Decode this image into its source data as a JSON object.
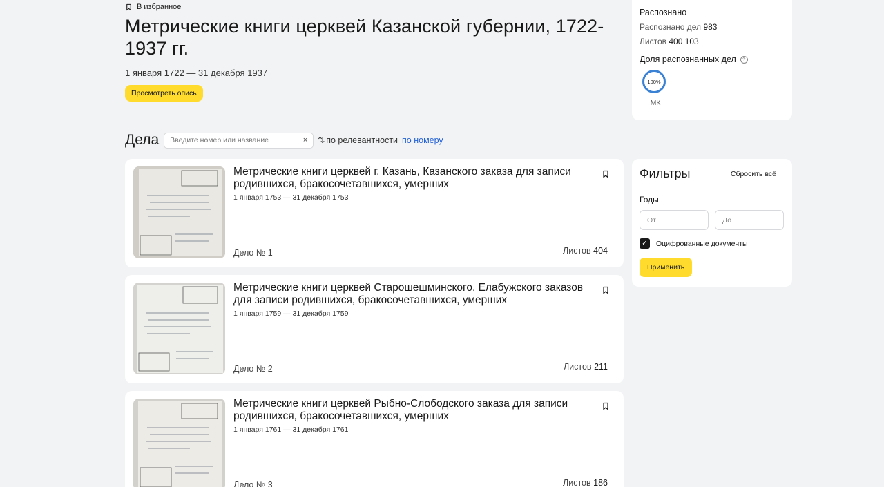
{
  "header": {
    "favorite_label": "В избранное",
    "title": "Метрические книги церквей Казанской губернии, 1722-1937 гг.",
    "date_range": "1 января 1722 — 31 декабря 1937",
    "inventory_button": "Просмотреть опись"
  },
  "cases_bar": {
    "title": "Дела",
    "search_placeholder": "Введите номер или название",
    "clear_icon": "×",
    "sort_icon": "⇅",
    "sort_relevance": "по релевантности",
    "sort_number": "по номеру"
  },
  "cases": [
    {
      "title": "Метрические книги церквей г. Казань, Казанского заказа для записи родившихся, бракосочетавшихся, умерших",
      "dates": "1 января 1753 — 31 декабря 1753",
      "case_no": "Дело № 1",
      "sheets_label": "Листов",
      "sheets": "404"
    },
    {
      "title": "Метрические книги церквей Старошешминского, Елабужского заказов для записи родившихся, бракосочетавшихся, умерших",
      "dates": "1 января 1759 — 31 декабря 1759",
      "case_no": "Дело № 2",
      "sheets_label": "Листов",
      "sheets": "211"
    },
    {
      "title": "Метрические книги церквей Рыбно-Слободского заказа для записи родившихся, бракосочетавшихся, умерших",
      "dates": "1 января 1761 — 31 декабря 1761",
      "case_no": "Дело № 3",
      "sheets_label": "Листов",
      "sheets": "186"
    }
  ],
  "stats": {
    "heading": "Распознано",
    "recognized_label": "Распознано дел",
    "recognized_value": "983",
    "sheets_label": "Листов",
    "sheets_value": "400 103",
    "share_label": "Доля распознанных дел",
    "ring_value": "100%",
    "ring_label": "МК",
    "accent_color": "#3b82d4"
  },
  "filters": {
    "title": "Фильтры",
    "reset": "Сбросить всё",
    "years_label": "Годы",
    "from_placeholder": "От",
    "to_placeholder": "До",
    "digitized_label": "Оцифрованные документы",
    "digitized_checked": true,
    "apply": "Применить",
    "button_color": "#ffdb2d"
  }
}
